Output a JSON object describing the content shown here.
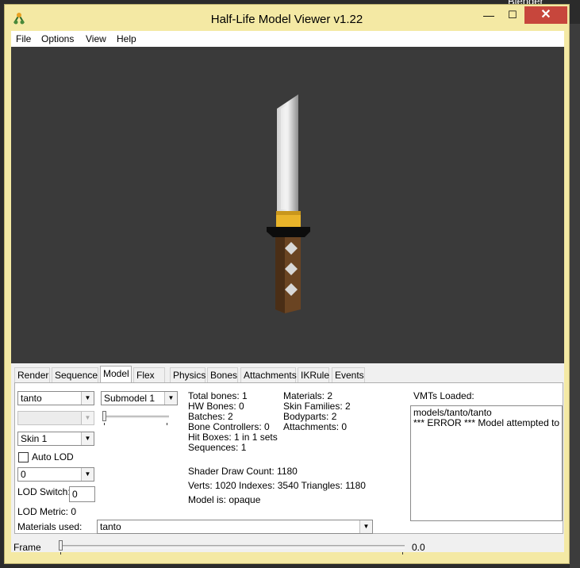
{
  "background": {
    "label": "Blender"
  },
  "window": {
    "title": "Half-Life Model Viewer v1.22",
    "minimize": "—",
    "maximize": "☐",
    "close": "✕"
  },
  "menu": [
    "File",
    "Options",
    "View",
    "Help"
  ],
  "tabs": [
    "Render",
    "Sequence",
    "Model",
    "Flex",
    "Physics",
    "Bones",
    "Attachments",
    "IKRule",
    "Events"
  ],
  "active_tab": "Model",
  "model": {
    "model_select": "tanto",
    "submodel_select": "Submodel 1",
    "bodypart_select": "",
    "skin_select": "Skin 1",
    "auto_lod_label": "Auto LOD",
    "auto_lod_checked": false,
    "lod_select": "0",
    "lod_switch_label": "LOD Switch:",
    "lod_switch_value": "0",
    "lod_metric": "LOD Metric:  0",
    "materials_used_label": "Materials used:",
    "materials_used_value": "tanto"
  },
  "stats_left": [
    "Total bones: 1",
    "HW Bones: 0",
    "Batches: 2",
    "Bone Controllers: 0",
    "Hit Boxes: 1 in 1 sets",
    "Sequences: 1"
  ],
  "stats_right": [
    "Materials: 2",
    "Skin Families: 2",
    "Bodyparts: 2",
    "Attachments: 0"
  ],
  "shader_draw_count": "Shader Draw Count: 1180",
  "verts_line": "Verts: 1020  Indexes: 3540  Triangles: 1180",
  "model_is": "Model is: opaque",
  "vmts": {
    "label": "VMTs Loaded:",
    "items": [
      "models/tanto/tanto",
      "*** ERROR *** Model attempted to load"
    ]
  },
  "frame": {
    "label": "Frame",
    "value": "0.0",
    "position": 0
  }
}
